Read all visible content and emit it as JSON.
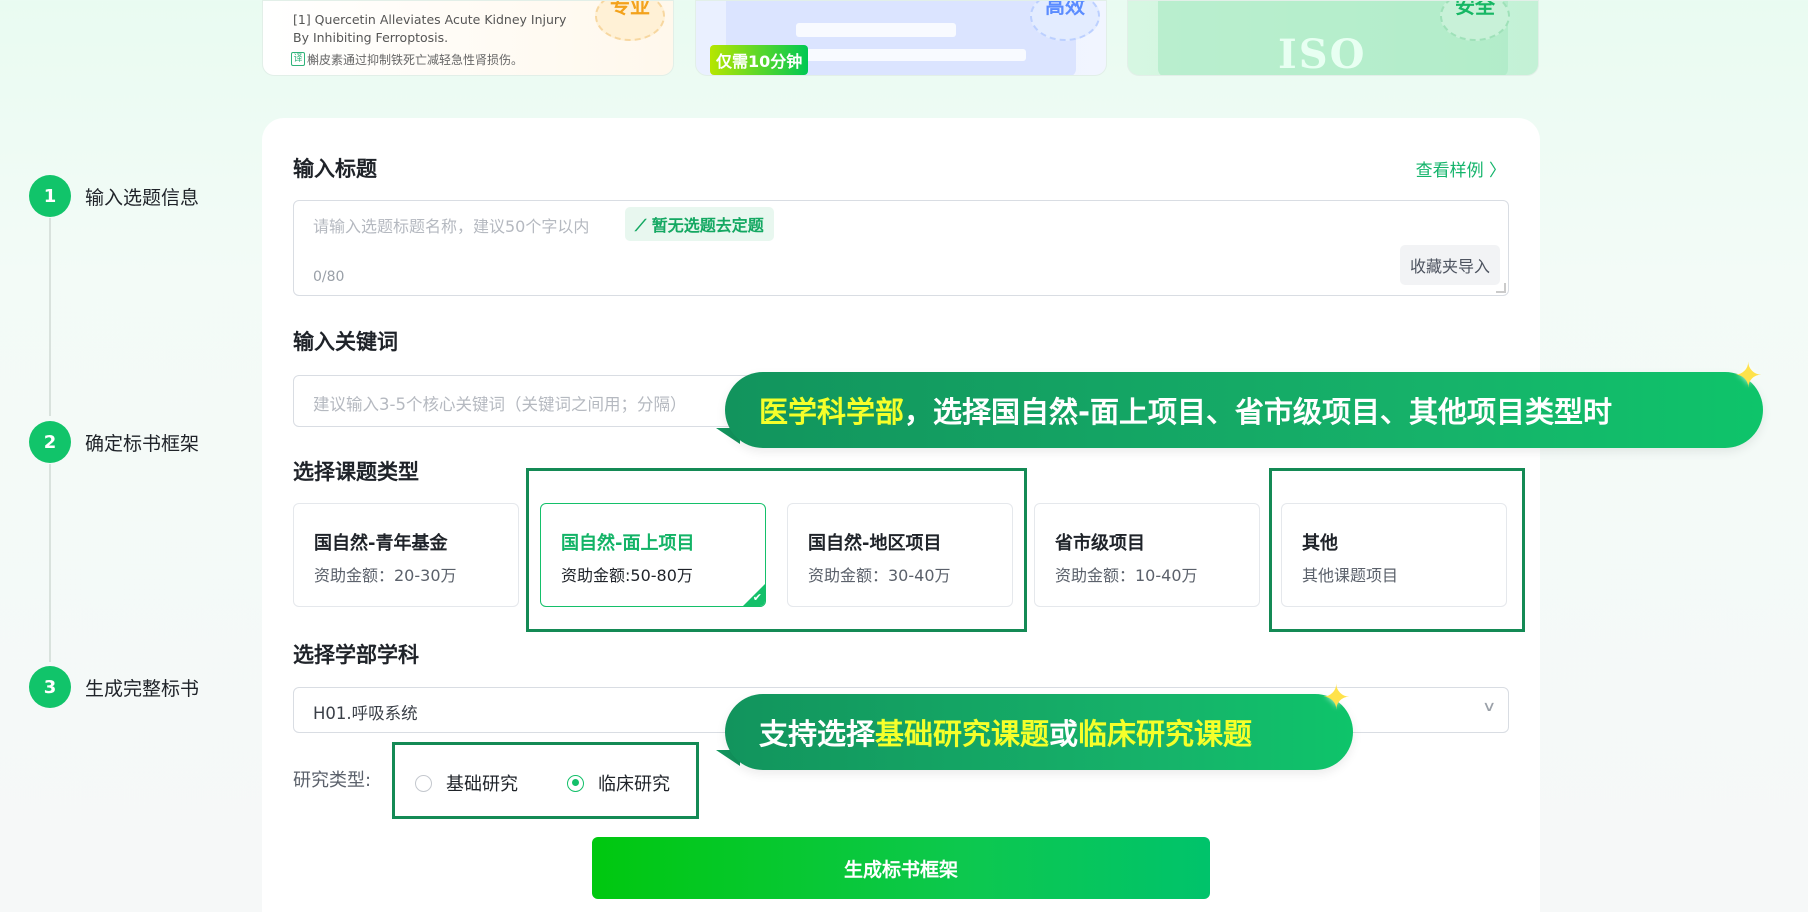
{
  "top_cards": {
    "card_a": {
      "ref_en": "[1] Quercetin Alleviates Acute Kidney Injury By Inhibiting Ferroptosis.",
      "ref_cn": "槲皮素通过抑制铁死亡减轻急性肾损伤。",
      "translate_icon_text": "译",
      "seal": "专业"
    },
    "card_b": {
      "seal": "高效",
      "tag": "仅需10分钟"
    },
    "card_c": {
      "seal": "安全",
      "iso": "ISO"
    }
  },
  "steps": [
    {
      "num": "1",
      "label": "输入选题信息"
    },
    {
      "num": "2",
      "label": "确定标书框架"
    },
    {
      "num": "3",
      "label": "生成完整标书"
    }
  ],
  "title_section": {
    "title": "输入标题",
    "sample_link": "查看样例 〉",
    "placeholder": "请输入选题标题名称，建议50个字以内",
    "topic_chip": "⟋ 暂无选题去定题",
    "count": "0/80",
    "import_button": "收藏夹导入"
  },
  "keyword_section": {
    "title": "输入关键词",
    "placeholder": "建议输入3-5个核心关键词（关键词之间用；分隔）"
  },
  "type_section": {
    "title": "选择课题类型",
    "types": [
      {
        "title": "国自然-青年基金",
        "sub": "资助金额：20-30万",
        "selected": false
      },
      {
        "title": "国自然-面上项目",
        "sub": "资助金额:50-80万",
        "selected": true
      },
      {
        "title": "国自然-地区项目",
        "sub": "资助金额：30-40万",
        "selected": false
      },
      {
        "title": "省市级项目",
        "sub": "资助金额：10-40万",
        "selected": false
      },
      {
        "title": "其他",
        "sub": "其他课题项目",
        "selected": false
      }
    ]
  },
  "subject_section": {
    "title": "选择学部学科",
    "selected": "H01.呼吸系统"
  },
  "research_type": {
    "label": "研究类型:",
    "options": [
      {
        "label": "基础研究",
        "checked": false
      },
      {
        "label": "临床研究",
        "checked": true
      }
    ]
  },
  "generate_button": "生成标书框架",
  "callouts": {
    "top": {
      "hl": "医学科学部",
      "rest": "，选择国自然-面上项目、省市级项目、其他项目类型时"
    },
    "bottom": {
      "pre": "支持选择",
      "hl1": "基础研究课题",
      "mid": "或",
      "hl2": "临床研究课题"
    }
  },
  "colors": {
    "accent": "#14c06a",
    "highlight_text": "#f5ff2a",
    "box_border": "#148a55"
  }
}
